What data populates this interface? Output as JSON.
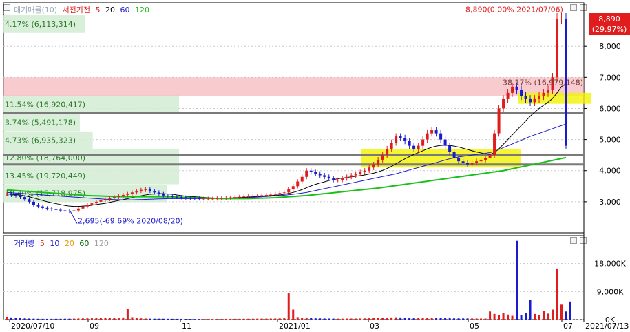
{
  "chart_data": [
    {
      "type": "candlestick",
      "legend": [
        {
          "text": "대기매물(10)",
          "color": "#9aa9b8"
        },
        {
          "text": "서전기전",
          "color": "#e11c1c"
        },
        {
          "text": "5",
          "color": "#e11c1c"
        },
        {
          "text": "20",
          "color": "#000000"
        },
        {
          "text": "60",
          "color": "#1a1ad0"
        },
        {
          "text": "120",
          "color": "#18c018"
        }
      ],
      "ylim": [
        2000,
        9400
      ],
      "y_ticks": [
        "8,000",
        "7,000",
        "6,000",
        "5,000",
        "4,000",
        "3,000"
      ],
      "last_price_label": "8,890",
      "last_change_label": "(29.97%)",
      "annotations": {
        "high": "8,890(0.00% 2021/07/06)",
        "low": "2,695(-69.69% 2020/08/20)",
        "top_pct": "38.17% (16,979,148)"
      },
      "volume_profile": [
        {
          "label": "4.17% (6,113,314)",
          "price_low": 8430,
          "price_high": 9000
        },
        {
          "label": "11.54% (16,920,417)",
          "price_low": 5850,
          "price_high": 6420
        },
        {
          "label": "3.74% (5,491,178)",
          "price_low": 5270,
          "price_high": 5840
        },
        {
          "label": "4.73% (6,935,323)",
          "price_low": 4700,
          "price_high": 5260
        },
        {
          "label": "12.80% (18,764,000)",
          "price_low": 4130,
          "price_high": 4690
        },
        {
          "label": "13.45% (19,720,449)",
          "price_low": 3560,
          "price_high": 4120
        },
        {
          "label": "10.40% (15,718,975)",
          "price_low": 2990,
          "price_high": 3550
        }
      ],
      "x_labels": [
        "2020/07/10",
        "09",
        "11",
        "2021/01",
        "03",
        "05",
        "07",
        "2021/07/13"
      ],
      "close": [
        3250,
        3220,
        3200,
        3150,
        3080,
        3000,
        2900,
        2850,
        2800,
        2780,
        2760,
        2740,
        2720,
        2710,
        2695,
        2720,
        2780,
        2850,
        2900,
        2950,
        3000,
        3050,
        3080,
        3120,
        3150,
        3180,
        3220,
        3250,
        3300,
        3350,
        3380,
        3400,
        3350,
        3300,
        3250,
        3200,
        3180,
        3160,
        3150,
        3140,
        3130,
        3120,
        3110,
        3100,
        3100,
        3100,
        3100,
        3110,
        3120,
        3130,
        3140,
        3150,
        3160,
        3170,
        3180,
        3190,
        3200,
        3210,
        3220,
        3230,
        3250,
        3280,
        3300,
        3400,
        3500,
        3650,
        3800,
        4000,
        3950,
        3900,
        3850,
        3800,
        3750,
        3700,
        3700,
        3750,
        3800,
        3850,
        3900,
        3950,
        4000,
        4100,
        4200,
        4350,
        4500,
        4700,
        4900,
        5100,
        5050,
        4950,
        4800,
        4700,
        4800,
        5000,
        5200,
        5300,
        5200,
        5000,
        4800,
        4600,
        4400,
        4300,
        4250,
        4200,
        4250,
        4300,
        4350,
        4400,
        4500,
        5200,
        6000,
        6300,
        6500,
        6700,
        6600,
        6400,
        6300,
        6200,
        6300,
        6400,
        6500,
        6600,
        7000,
        8890,
        8890,
        4800
      ],
      "ma": {
        "20": [
          3250,
          3240,
          3230,
          3210,
          3190,
          3160,
          3120,
          3080,
          3040,
          3000,
          2970,
          2940,
          2910,
          2880,
          2860,
          2850,
          2850,
          2860,
          2870,
          2890,
          2910,
          2930,
          2950,
          2980,
          3010,
          3040,
          3070,
          3100,
          3130,
          3160,
          3190,
          3220,
          3240,
          3250,
          3260,
          3260,
          3250,
          3240,
          3220,
          3200,
          3180,
          3170,
          3160,
          3150,
          3140,
          3130,
          3120,
          3120,
          3120,
          3120,
          3120,
          3130,
          3130,
          3140,
          3150,
          3160,
          3170,
          3180,
          3190,
          3200,
          3210,
          3220,
          3240,
          3270,
          3300,
          3340,
          3390,
          3450,
          3510,
          3560,
          3600,
          3640,
          3680,
          3710,
          3740,
          3760,
          3780,
          3800,
          3820,
          3840,
          3860,
          3890,
          3920,
          3960,
          4010,
          4070,
          4140,
          4220,
          4300,
          4380,
          4450,
          4520,
          4580,
          4640,
          4700,
          4750,
          4790,
          4810,
          4820,
          4810,
          4790,
          4760,
          4720,
          4680,
          4640,
          4600,
          4570,
          4540,
          4520,
          4580,
          4700,
          4850,
          5000,
          5150,
          5300,
          5450,
          5600,
          5750,
          5880,
          6000,
          6100,
          6200,
          6320,
          6500,
          6700,
          6800
        ],
        "60": [
          3300,
          3290,
          3280,
          3270,
          3260,
          3250,
          3240,
          3230,
          3220,
          3210,
          3200,
          3190,
          3180,
          3170,
          3160,
          3150,
          3140,
          3130,
          3120,
          3110,
          3100,
          3090,
          3080,
          3075,
          3070,
          3065,
          3060,
          3060,
          3060,
          3065,
          3070,
          3075,
          3080,
          3085,
          3090,
          3095,
          3100,
          3100,
          3100,
          3100,
          3100,
          3100,
          3100,
          3100,
          3100,
          3100,
          3100,
          3100,
          3100,
          3100,
          3100,
          3100,
          3110,
          3120,
          3130,
          3140,
          3150,
          3160,
          3170,
          3180,
          3190,
          3200,
          3210,
          3225,
          3240,
          3260,
          3280,
          3300,
          3330,
          3360,
          3390,
          3420,
          3450,
          3480,
          3510,
          3540,
          3570,
          3600,
          3630,
          3660,
          3690,
          3720,
          3750,
          3780,
          3810,
          3840,
          3870,
          3900,
          3940,
          3980,
          4020,
          4060,
          4100,
          4140,
          4180,
          4220,
          4260,
          4300,
          4340,
          4380,
          4410,
          4440,
          4460,
          4480,
          4500,
          4520,
          4540,
          4560,
          4580,
          4620,
          4680,
          4740,
          4800,
          4860,
          4920,
          4980,
          5040,
          5100,
          5150,
          5200,
          5250,
          5300,
          5350,
          5400,
          5450,
          5500
        ],
        "120": [
          3380,
          3370,
          3360,
          3350,
          3340,
          3330,
          3320,
          3310,
          3300,
          3290,
          3280,
          3270,
          3260,
          3250,
          3240,
          3230,
          3220,
          3210,
          3200,
          3195,
          3190,
          3185,
          3180,
          3175,
          3170,
          3165,
          3160,
          3160,
          3160,
          3160,
          3160,
          3160,
          3160,
          3160,
          3160,
          3160,
          3160,
          3155,
          3150,
          3145,
          3140,
          3135,
          3130,
          3125,
          3120,
          3115,
          3110,
          3105,
          3100,
          3100,
          3100,
          3100,
          3100,
          3100,
          3100,
          3105,
          3110,
          3115,
          3120,
          3125,
          3130,
          3140,
          3150,
          3160,
          3170,
          3180,
          3190,
          3200,
          3215,
          3230,
          3245,
          3260,
          3275,
          3290,
          3305,
          3320,
          3335,
          3350,
          3365,
          3380,
          3395,
          3410,
          3425,
          3440,
          3460,
          3480,
          3500,
          3520,
          3540,
          3560,
          3580,
          3600,
          3620,
          3640,
          3660,
          3680,
          3700,
          3720,
          3740,
          3760,
          3780,
          3800,
          3820,
          3840,
          3860,
          3880,
          3900,
          3920,
          3940,
          3960,
          3980,
          4000,
          4030,
          4060,
          4090,
          4120,
          4150,
          4180,
          4210,
          4240,
          4270,
          4300,
          4330,
          4360,
          4390,
          4420
        ]
      }
    },
    {
      "type": "bar",
      "legend": [
        {
          "text": "거래량",
          "color": "#1a1ad0"
        },
        {
          "text": "5",
          "color": "#e11c1c"
        },
        {
          "text": "10",
          "color": "#1a1ad0"
        },
        {
          "text": "20",
          "color": "#e0a000"
        },
        {
          "text": "60",
          "color": "#006000"
        },
        {
          "text": "120",
          "color": "#a0a0a0"
        }
      ],
      "y_ticks": [
        "18,000K",
        "9,000K",
        "0K"
      ],
      "ylim": [
        0,
        27000
      ],
      "volume_k": [
        900,
        700,
        600,
        500,
        400,
        350,
        300,
        280,
        260,
        240,
        250,
        260,
        270,
        280,
        300,
        320,
        350,
        380,
        400,
        420,
        450,
        500,
        520,
        550,
        600,
        650,
        700,
        3500,
        800,
        500,
        400,
        350,
        300,
        300,
        300,
        280,
        260,
        250,
        240,
        230,
        220,
        210,
        200,
        200,
        200,
        200,
        200,
        210,
        220,
        230,
        240,
        250,
        260,
        270,
        280,
        290,
        300,
        310,
        320,
        330,
        350,
        380,
        420,
        8400,
        3200,
        800,
        600,
        500,
        450,
        400,
        380,
        360,
        340,
        320,
        300,
        310,
        320,
        330,
        340,
        350,
        380,
        420,
        460,
        500,
        560,
        620,
        700,
        760,
        700,
        650,
        600,
        580,
        560,
        540,
        520,
        500,
        480,
        460,
        440,
        420,
        400,
        390,
        380,
        370,
        360,
        350,
        340,
        330,
        2600,
        1800,
        1400,
        2200,
        1600,
        1200,
        25300,
        1500,
        2000,
        6400,
        1800,
        1500,
        2800,
        1900,
        3200,
        16400,
        4800,
        2600,
        5800
      ]
    }
  ]
}
